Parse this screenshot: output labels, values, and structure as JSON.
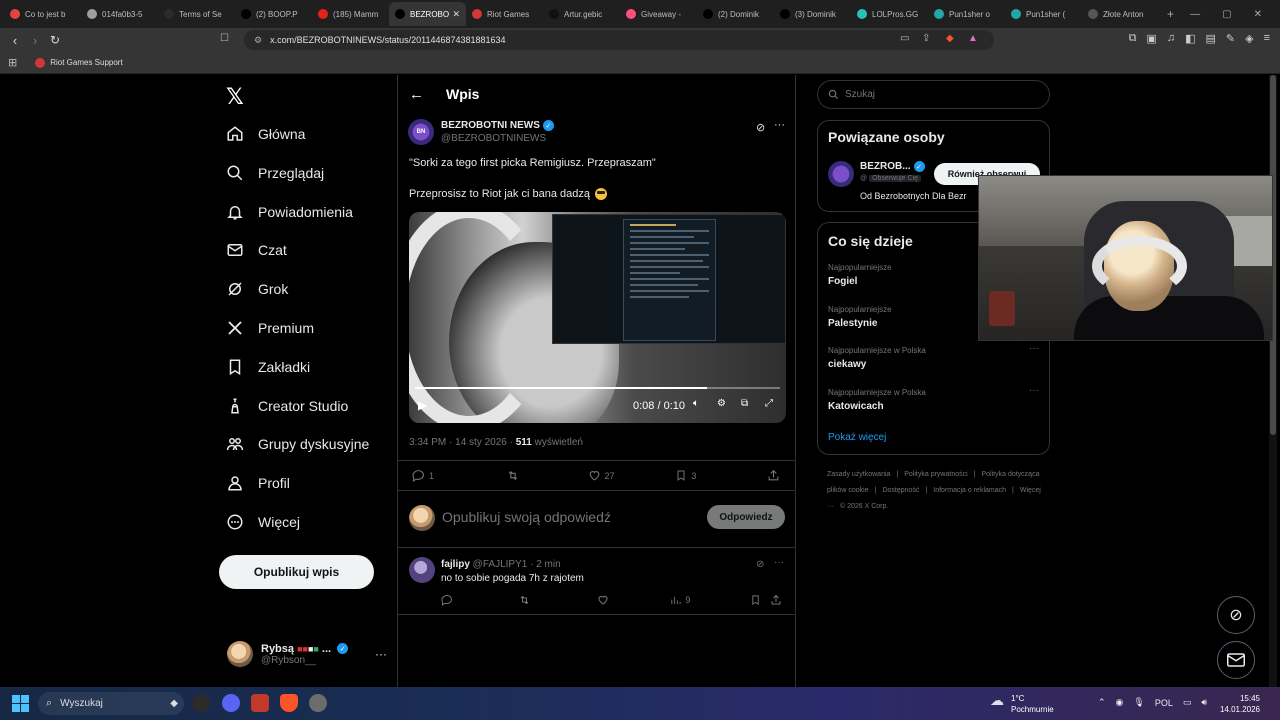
{
  "browser": {
    "tabs": [
      {
        "title": "Co to jest b",
        "color": "#e3443f"
      },
      {
        "title": "014fa0b3-5",
        "color": "#9e9e9e"
      },
      {
        "title": "Terms of Se",
        "color": "#2b2b2b"
      },
      {
        "title": "(2) BOOP.P",
        "color": "#000000"
      },
      {
        "title": "(185) Mamm",
        "color": "#e62117"
      },
      {
        "title": "BEZROBO",
        "color": "#000000",
        "active": true
      },
      {
        "title": "Riot Games",
        "color": "#d13639"
      },
      {
        "title": "Artur.gebic",
        "color": "#111111"
      },
      {
        "title": "Giveaway -",
        "color": "#ff4f7a"
      },
      {
        "title": "(2) Dominik",
        "color": "#000000"
      },
      {
        "title": "(3) Dominik",
        "color": "#000000"
      },
      {
        "title": "LOLPros.GG",
        "color": "#27c4b4"
      },
      {
        "title": "Pun1sher o",
        "color": "#22a6a6"
      },
      {
        "title": "Pun1sher (",
        "color": "#22a6a6"
      },
      {
        "title": "Złote Anton",
        "color": "#555555"
      }
    ],
    "url": "x.com/BEZROBOTNINEWS/status/2011446874381881634",
    "bookmark": "Riot Games Support"
  },
  "nav": {
    "items": [
      {
        "label": "Główna",
        "icon": "home-icon"
      },
      {
        "label": "Przeglądaj",
        "icon": "search-icon"
      },
      {
        "label": "Powiadomienia",
        "icon": "bell-icon"
      },
      {
        "label": "Czat",
        "icon": "mail-icon"
      },
      {
        "label": "Grok",
        "icon": "grok-icon"
      },
      {
        "label": "Premium",
        "icon": "x-icon"
      },
      {
        "label": "Zakładki",
        "icon": "bookmark-icon"
      },
      {
        "label": "Creator Studio",
        "icon": "flask-icon"
      },
      {
        "label": "Grupy dyskusyjne",
        "icon": "people-icon"
      },
      {
        "label": "Profil",
        "icon": "person-icon"
      },
      {
        "label": "Więcej",
        "icon": "more-circle-icon"
      }
    ],
    "post_label": "Opublikuj wpis",
    "account_name": "Rybsą",
    "account_handle": "@Rybson__"
  },
  "post": {
    "header_title": "Wpis",
    "author_name": "BEZROBOTNI NEWS",
    "author_handle": "@BEZROBOTNINEWS",
    "avatar_text": "BN",
    "text1": "\"Sorki za tego first picka Remigiusz. Przepraszam\"",
    "text2": "Przeprosisz to Riot jak ci bana dadzą",
    "video": {
      "time": "0:08 / 0:10",
      "progress": 0.8
    },
    "timestamp": "3:34 PM · 14 sty 2026 · ",
    "views_count": "511",
    "views_label": " wyświetleń",
    "replies": "1",
    "reposts": "",
    "likes": "27",
    "bookmarks": "3",
    "reply_placeholder": "Opublikuj swoją odpowiedź",
    "reply_button": "Odpowiedz"
  },
  "comment": {
    "name": "fajlipy",
    "meta": " @FAJLIPY1 · 2 min",
    "text": "no to sobie pogada 7h z rajotem",
    "views": "9"
  },
  "sidebar": {
    "search_placeholder": "Szukaj",
    "people_title": "Powiązane osoby",
    "person_name": "BEZROB...",
    "person_handle": "@",
    "person_follows_you": "Obserwuje Cię",
    "follow_label": "Również obserwuj",
    "person_bio": "Od Bezrobotnych Dla Bezr",
    "trends_title": "Co się dzieje",
    "trends": [
      {
        "meta": "Najpopularniejsze",
        "name": "Fogiel"
      },
      {
        "meta": "Najpopularniejsze",
        "name": "Palestynie"
      },
      {
        "meta": "Najpopularniejsze w Polska",
        "name": "ciekawy"
      },
      {
        "meta": "Najpopularniejsze w Polska",
        "name": "Katowicach"
      }
    ],
    "show_more": "Pokaż więcej",
    "footer": [
      "Zasady użytkowania",
      "|",
      "Polityka prywatności",
      "|",
      "Polityka dotycząca plików cookie",
      "|",
      "Dostępność",
      "|",
      "Informacja o reklamach",
      "|",
      "Więcej ···",
      "© 2026 X Corp."
    ]
  },
  "taskbar": {
    "search_placeholder": "Wyszukaj",
    "weather_temp": "1°C",
    "weather_desc": "Pochmurnie",
    "lang": "POL",
    "time": "15:45",
    "date": "14.01.2026"
  },
  "colors": {
    "accent": "#1d9bf0",
    "background": "#000000",
    "border": "#2f3336"
  }
}
